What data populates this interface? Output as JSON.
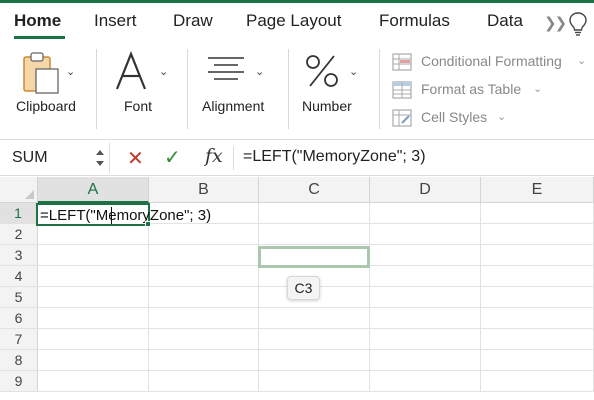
{
  "tabs": [
    {
      "label": "Home",
      "active": true
    },
    {
      "label": "Insert",
      "active": false
    },
    {
      "label": "Draw",
      "active": false
    },
    {
      "label": "Page Layout",
      "active": false
    },
    {
      "label": "Formulas",
      "active": false
    },
    {
      "label": "Data",
      "active": false
    }
  ],
  "tabs_more_icon": "double-chevron-right-icon",
  "tell_me_icon": "lightbulb-icon",
  "ribbon": {
    "groups": [
      {
        "label": "Clipboard",
        "icon": "clipboard-icon"
      },
      {
        "label": "Font",
        "icon": "font-a-icon"
      },
      {
        "label": "Alignment",
        "icon": "align-lines-icon"
      },
      {
        "label": "Number",
        "icon": "percent-icon"
      }
    ],
    "styles": [
      {
        "label": "Conditional Formatting",
        "icon": "conditional-formatting-icon"
      },
      {
        "label": "Format as Table",
        "icon": "format-as-table-icon"
      },
      {
        "label": "Cell Styles",
        "icon": "cell-styles-icon"
      }
    ]
  },
  "formula_bar": {
    "name_box": "SUM",
    "fx_label": "fx",
    "formula": "=LEFT(\"MemoryZone\"; 3)"
  },
  "grid": {
    "columns": [
      "A",
      "B",
      "C",
      "D",
      "E"
    ],
    "rows": [
      "1",
      "2",
      "3",
      "4",
      "5",
      "6",
      "7",
      "8",
      "9"
    ],
    "selected_column": "A",
    "selected_row": "1",
    "editing_cell": "A1",
    "editing_text": "=LEFT(\"MemoryZone\"; 3)",
    "reference_cell": "C3",
    "reference_tooltip": "C3"
  },
  "colors": {
    "accent": "#1e7145",
    "cancel": "#c0392b",
    "enter": "#2e8b3a",
    "reference_border": "#a9c8ae"
  }
}
